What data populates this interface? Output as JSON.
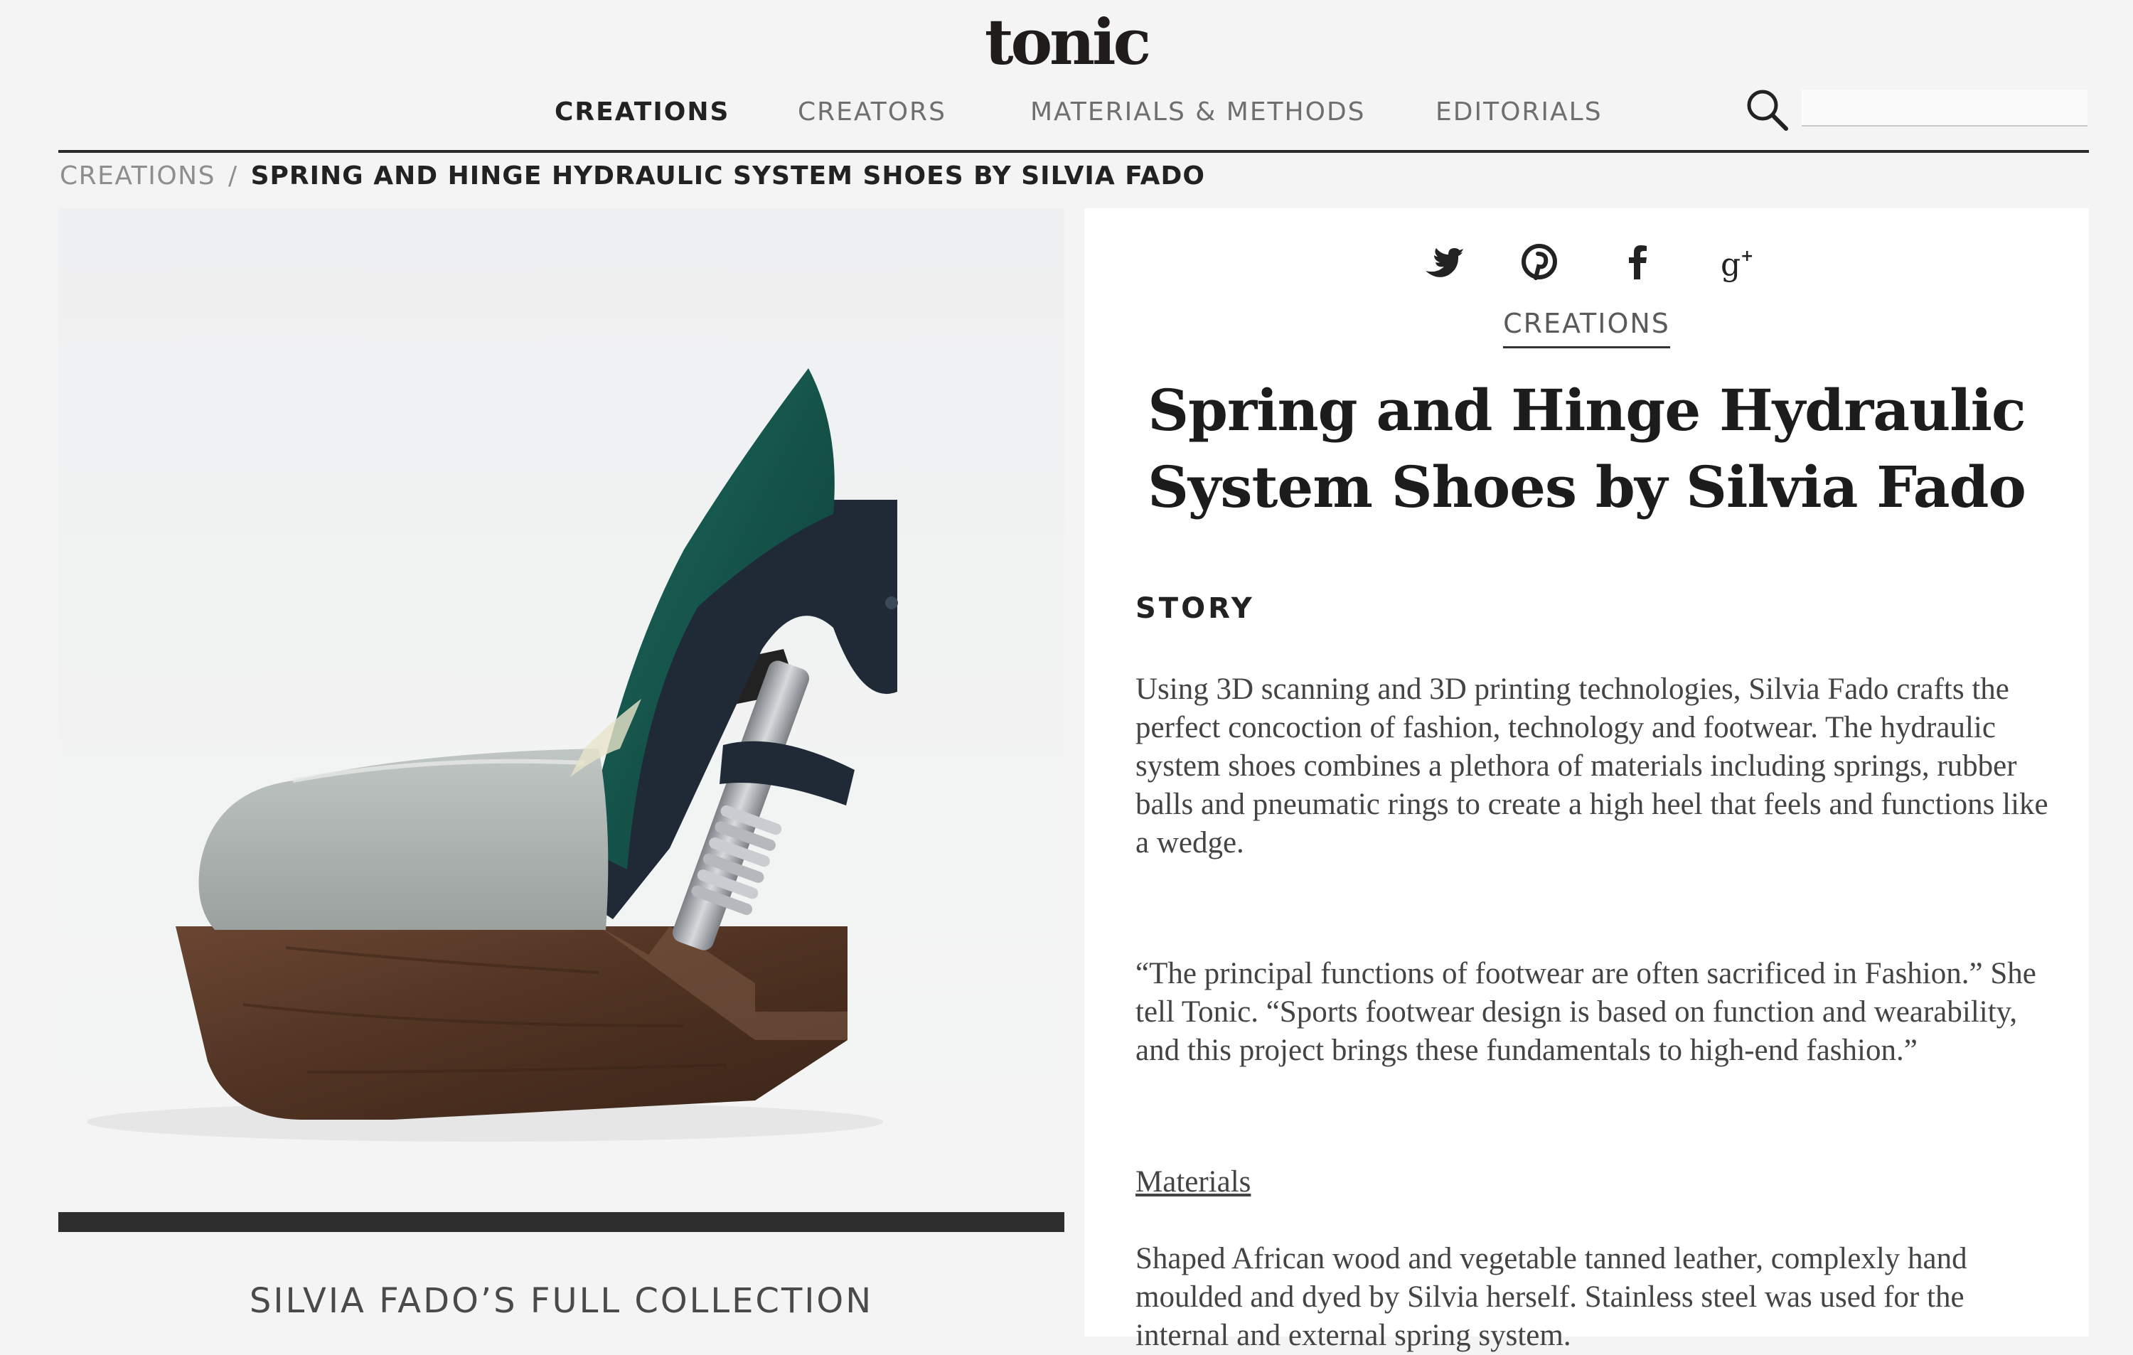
{
  "brand": {
    "logo": "tonic"
  },
  "nav": {
    "items": [
      {
        "label": "CREATIONS",
        "active": true
      },
      {
        "label": "CREATORS",
        "active": false
      },
      {
        "label": "MATERIALS & METHODS",
        "active": false
      },
      {
        "label": "EDITORIALS",
        "active": false
      }
    ],
    "search": {
      "icon": "search-icon",
      "value": "",
      "placeholder": ""
    }
  },
  "breadcrumb": {
    "parent": "CREATIONS",
    "separator": "/",
    "current": "SPRING AND HINGE HYDRAULIC SYSTEM SHOES BY SILVIA FADO"
  },
  "gallery": {
    "caption_link": "SILVIA FADO’S FULL COLLECTION"
  },
  "share": [
    "twitter-icon",
    "pinterest-icon",
    "facebook-icon",
    "google-plus-icon"
  ],
  "article": {
    "category": "CREATIONS",
    "title": "Spring and Hinge Hydraulic System Shoes by Silvia Fado",
    "section_heading": "STORY",
    "paragraphs": [
      "Using 3D scanning and 3D printing technologies, Silvia Fado crafts the perfect concoction of fashion, technology and footwear. The hydraulic system shoes combines a plethora of materials including springs, rubber balls and pneumatic rings to create a high heel that feels and functions like a wedge.",
      "“The principal functions of footwear are often sacrificed in Fashion.” She tell Tonic. “Sports footwear design is based on function and wearability, and this project brings these fundamentals to high-end fashion.”",
      "Shaped African wood and vegetable tanned leather, complexly hand moulded and dyed by Silvia herself. Stainless steel was used for the internal and external spring system."
    ],
    "materials_link": "Materials"
  },
  "colors": {
    "background": "#f4f4f4",
    "panel": "#ffffff",
    "text_dark": "#1c1c1c",
    "shoe_leather": "#a9b0ad",
    "shoe_accent": "#0f4f45",
    "wood": "#5a3a28",
    "bracket": "#1f2a36"
  }
}
